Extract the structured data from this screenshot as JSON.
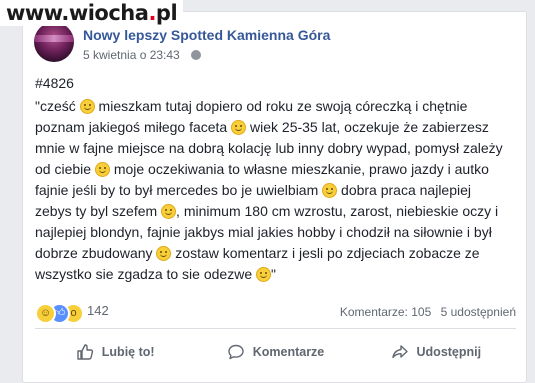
{
  "watermark": {
    "pre": "www.wiocha",
    "dot": ".",
    "post": "pl"
  },
  "post": {
    "page_name": "Nowy lepszy Spotted Kamienna Góra",
    "date": "5 kwietnia o 23:43",
    "tag": "#4826",
    "lines": [
      "\"cześć",
      " mieszkam tutaj dopiero od roku ze swoją córeczką i chętnie",
      "poznam jakiegoś miłego faceta",
      " wiek 25-35 lat, oczekuje że zabierzesz",
      "mnie w fajne miejsce na dobrą kolację lub inny dobry wypad, pomysł zależy",
      "od ciebie",
      " moje oczekiwania to własne mieszkanie, prawo jazdy i autko",
      "fajnie jeśli by to był mercedes bo je uwielbiam",
      " dobra praca najlepiej",
      "zebys ty byl szefem",
      ", minimum 180 cm wzrostu, zarost, niebieskie oczy i",
      "najlepiej blondyn, fajnie jakbys mial jakies hobby i chodził na siłownie i był",
      "dobrze zbudowany",
      " zostaw komentarz i jesli po zdjeciach zobacze ze",
      "wszystko sie zgadza to sie odezwe",
      "\""
    ],
    "emoji_name": "smile-emoji"
  },
  "stats": {
    "reaction_count": "142",
    "comments": "Komentarze: 105",
    "shares": "5 udostępnień",
    "reaction_icons": [
      "haha-reaction-icon",
      "like-reaction-icon",
      "wow-reaction-icon"
    ]
  },
  "actions": {
    "like": "Lubię to!",
    "comment": "Komentarze",
    "share": "Udostępnij"
  },
  "colors": {
    "link": "#365899",
    "text": "#1d2129",
    "secondary": "#616770",
    "background": "#e9ebee",
    "watermark_dot": "#e0001a"
  }
}
